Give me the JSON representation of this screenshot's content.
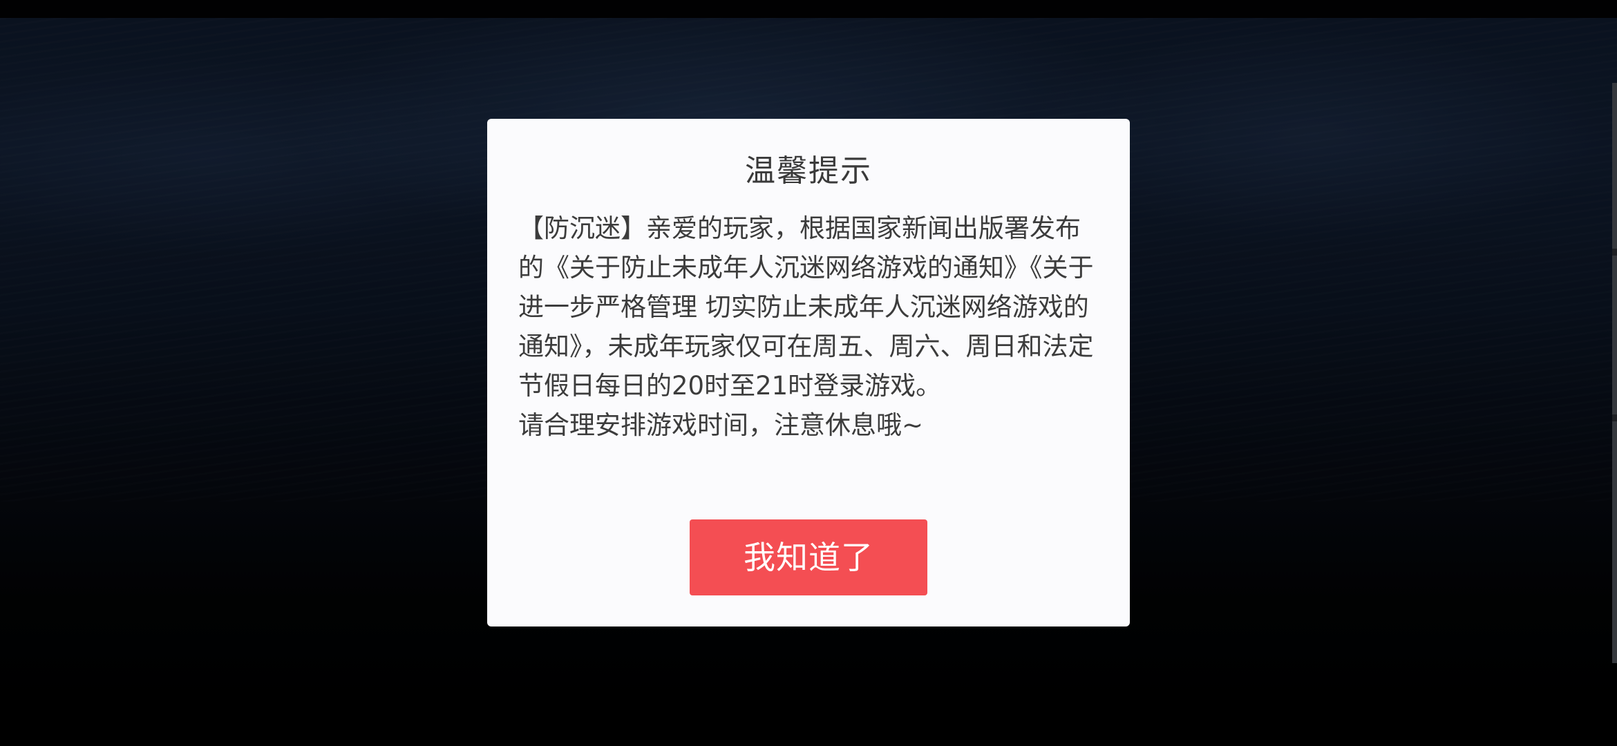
{
  "dialog": {
    "title": "温馨提示",
    "body_paragraphs": [
      "【防沉迷】亲爱的玩家，根据国家新闻出版署发布的《关于防止未成年人沉迷网络游戏的通知》《关于进一步严格管理 切实防止未成年人沉迷网络游戏的通知》，未成年玩家仅可在周五、周六、周日和法定节假日每日的20时至21时登录游戏。",
      "请合理安排游戏时间，注意休息哦~"
    ],
    "confirm_label": "我知道了"
  },
  "colors": {
    "dialog_background": "#fbfbfd",
    "button_accent": "#f44e53",
    "text": "#3c3c3c",
    "backdrop": "#0c1524"
  }
}
